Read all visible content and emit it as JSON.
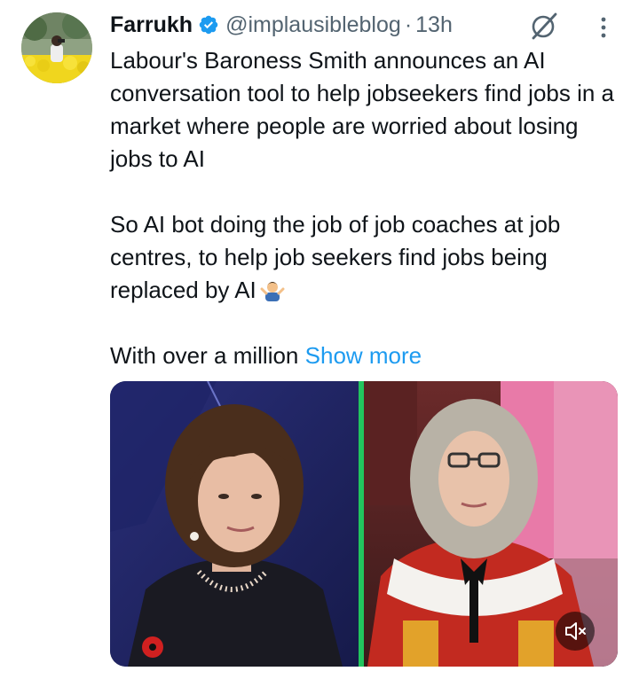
{
  "tweet": {
    "author": {
      "display_name": "Farrukh",
      "handle": "@implausibleblog",
      "verified": true
    },
    "separator": "·",
    "time": "13h",
    "text": {
      "paragraph1": "Labour's Baroness Smith announces an AI conversation tool to help jobseekers find jobs in a market where people are worried about losing jobs to AI",
      "paragraph2": "So AI bot doing the job of job coaches at job centres, to help job seekers find jobs being replaced by AI",
      "paragraph2_emoji": "person-shrugging-emoji",
      "paragraph3": "With over a million",
      "show_more": "Show more"
    },
    "media": {
      "type": "video",
      "panels": [
        "woman-in-dark-jacket-blue-background",
        "woman-in-red-ermine-robes-house-of-lords"
      ],
      "divider_color": "#22c55e"
    }
  },
  "icons": {
    "verified": "verified-badge-icon",
    "grok": "grok-icon",
    "more": "more-options-icon",
    "mute": "muted-speaker-icon"
  },
  "colors": {
    "text": "#0f1419",
    "secondary": "#536471",
    "link": "#1d9bf0",
    "verified": "#1d9bf0"
  }
}
